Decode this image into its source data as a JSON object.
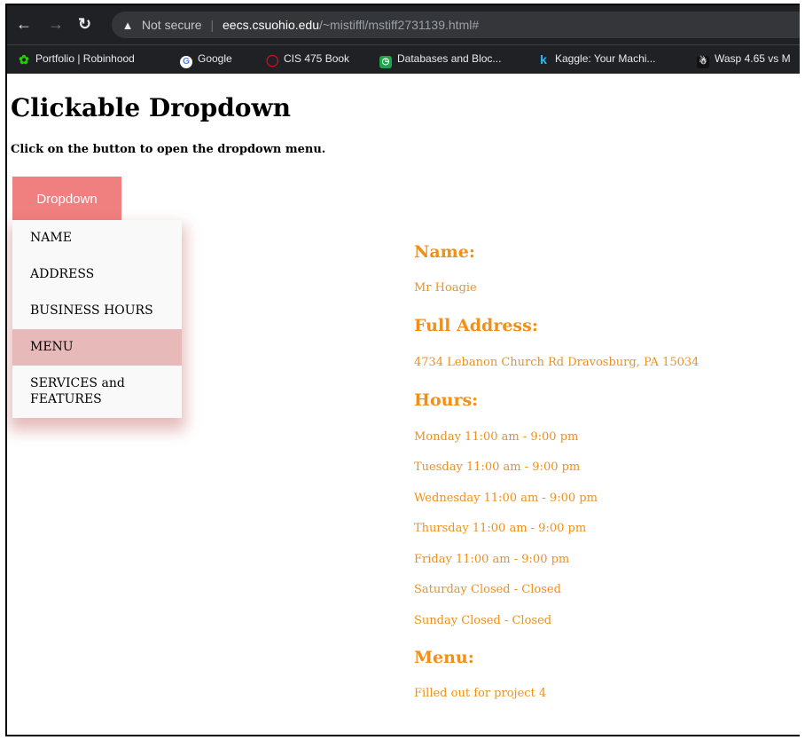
{
  "browser": {
    "address_bar": {
      "security_label": "Not secure",
      "separator": "|",
      "host": "eecs.csuohio.edu",
      "path": "/~mistiffl/mstiff2731139.html#"
    },
    "bookmarks": [
      {
        "label": "Portfolio | Robinhood",
        "icon": "robinhood-feather-icon"
      },
      {
        "label": "Google",
        "icon": "google-g-icon",
        "glyph": "G"
      },
      {
        "label": "CIS 475 Book",
        "icon": "oreilly-icon"
      },
      {
        "label": "Databases and Bloc...",
        "icon": "green-clock-icon"
      },
      {
        "label": "Kaggle: Your Machi...",
        "icon": "kaggle-k-icon",
        "glyph": "k"
      },
      {
        "label": "Wasp 4.65 vs M",
        "icon": "wasp-icon"
      }
    ]
  },
  "page": {
    "heading": "Clickable Dropdown",
    "instruction": "Click on the button to open the dropdown menu.",
    "dropdown_button_label": "Dropdown",
    "dropdown_items": [
      "NAME",
      "ADDRESS",
      "BUSINESS HOURS",
      "MENU",
      "SERVICES and FEATURES"
    ],
    "hovered_item": "MENU",
    "accent_color": "#f08080",
    "text_color": "#f0901a"
  },
  "details": {
    "name_heading": "Name:",
    "name_value": "Mr Hoagie",
    "address_heading": "Full Address:",
    "address_value": "4734 Lebanon Church Rd Dravosburg, PA 15034",
    "hours_heading": "Hours:",
    "hours": [
      "Monday 11:00 am - 9:00 pm",
      "Tuesday 11:00 am - 9:00 pm",
      "Wednesday 11:00 am - 9:00 pm",
      "Thursday 11:00 am - 9:00 pm",
      "Friday 11:00 am - 9:00 pm",
      "Saturday Closed - Closed",
      "Sunday Closed - Closed"
    ],
    "menu_heading": "Menu:",
    "menu_value": "Filled out for project 4"
  }
}
